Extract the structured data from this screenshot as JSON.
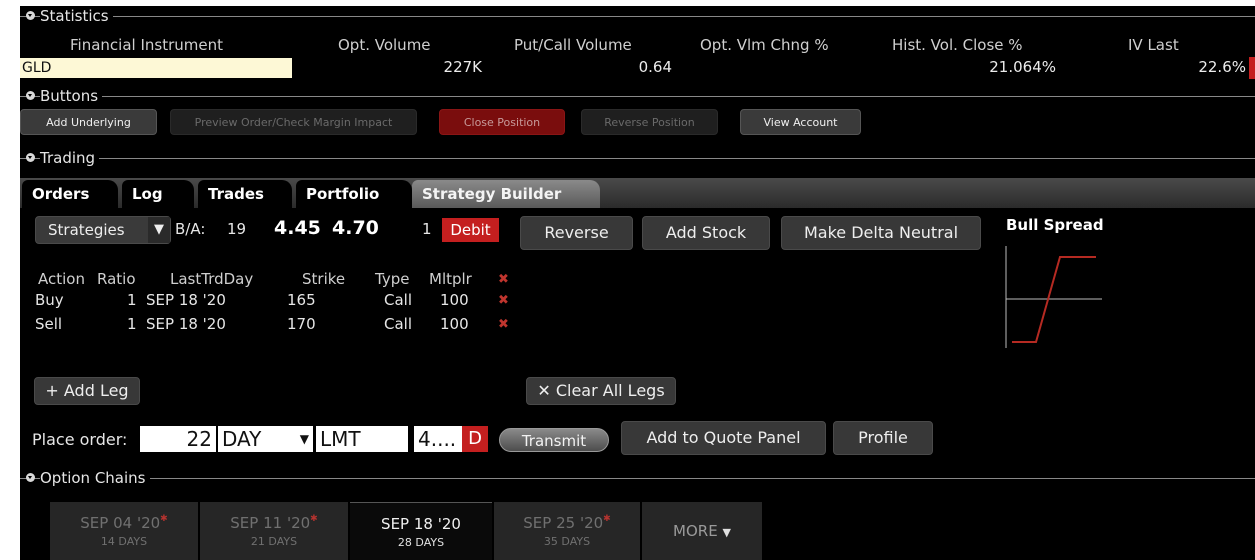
{
  "sections": {
    "statistics": "Statistics",
    "buttons": "Buttons",
    "trading": "Trading",
    "option_chains": "Option Chains"
  },
  "statistics": {
    "labels": {
      "instrument": "Financial Instrument",
      "opt_volume": "Opt. Volume",
      "put_call": "Put/Call Volume",
      "vlm_chng": "Opt. Vlm Chng %",
      "hist_vol": "Hist. Vol. Close %",
      "iv_last": "IV Last"
    },
    "values": {
      "instrument": "GLD",
      "opt_volume": "227K",
      "put_call": "0.64",
      "vlm_chng": "",
      "hist_vol": "21.064%",
      "iv_last": "22.6%"
    }
  },
  "buttons": {
    "add_underlying": "Add Underlying",
    "preview_order": "Preview Order/Check Margin Impact",
    "close_position": "Close Position",
    "reverse_position": "Reverse Position",
    "view_account": "View Account"
  },
  "tabs": [
    "Orders",
    "Log",
    "Trades",
    "Portfolio",
    "Strategy Builder"
  ],
  "strategy": {
    "strategies_label": "Strategies",
    "ba_label": "B/A:",
    "ba_size": "19",
    "bid": "4.45",
    "ask": "4.70",
    "qty": "1",
    "debit": "Debit",
    "reverse": "Reverse",
    "add_stock": "Add Stock",
    "make_delta_neutral": "Make Delta Neutral",
    "chart_title": "Bull Spread"
  },
  "legs": {
    "headers": [
      "Action",
      "Ratio",
      "LastTrdDay",
      "Strike",
      "Type",
      "Mltplr"
    ],
    "rows": [
      {
        "action": "Buy",
        "ratio": "1",
        "last": "SEP 18 '20",
        "strike": "165",
        "type": "Call",
        "mult": "100"
      },
      {
        "action": "Sell",
        "ratio": "1",
        "last": "SEP 18 '20",
        "strike": "170",
        "type": "Call",
        "mult": "100"
      }
    ],
    "add_leg": "Add Leg",
    "clear_all": "Clear All Legs"
  },
  "order": {
    "label": "Place order:",
    "qty": "22",
    "tif": "DAY",
    "type": "LMT",
    "price": "4....",
    "side": "D",
    "transmit": "Transmit",
    "add_quote": "Add to Quote Panel",
    "profile": "Profile"
  },
  "chains": [
    {
      "date": "SEP 04 '20",
      "days": "14 DAYS",
      "star": true
    },
    {
      "date": "SEP 11 '20",
      "days": "21 DAYS",
      "star": true
    },
    {
      "date": "SEP 18 '20",
      "days": "28 DAYS",
      "star": false
    },
    {
      "date": "SEP 25 '20",
      "days": "35 DAYS",
      "star": true
    }
  ],
  "more": "MORE",
  "colors": {
    "accent_red": "#c41f1f",
    "highlight": "#fdf8d6",
    "payoff": "#b52a22"
  }
}
